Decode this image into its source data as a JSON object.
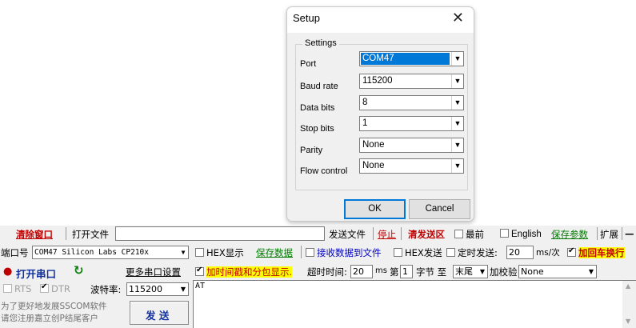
{
  "setup": {
    "title": "Setup",
    "close": "✕",
    "group": "Settings",
    "rows": [
      {
        "label": "Port",
        "value": "COM47"
      },
      {
        "label": "Baud rate",
        "value": "115200"
      },
      {
        "label": "Data bits",
        "value": "8"
      },
      {
        "label": "Stop bits",
        "value": "1"
      },
      {
        "label": "Parity",
        "value": "None"
      },
      {
        "label": "Flow control",
        "value": "None"
      }
    ],
    "ok": "OK",
    "cancel": "Cancel"
  },
  "toolbar": {
    "clear_window": "清除窗口",
    "open_file": "打开文件",
    "send_file": "发送文件",
    "stop": "停止",
    "clear_send": "清发送区",
    "topmost": "最前",
    "english": "English",
    "save_params": "保存参数",
    "expand": "扩展",
    "dash": "—"
  },
  "port": {
    "label": "端口号",
    "value": "COM47 Silicon Labs CP210x",
    "open_button": "打开串口",
    "more_settings": "更多串口设置",
    "rts": "RTS",
    "dtr": "DTR",
    "baud_label": "波特率:",
    "baud_value": "115200"
  },
  "options": {
    "hex_display": "HEX显示",
    "save_data": "保存数据",
    "recv_to_file": "接收数据到文件",
    "hex_send": "HEX发送",
    "timed_send": "定时发送:",
    "interval": "20",
    "interval_unit": "ms/次",
    "add_crlf": "加回车换行",
    "timestamp": "加时间戳和分包显示.",
    "timeout_label": "超时时间:",
    "timeout_value": "20",
    "timeout_unit": "ms",
    "byte_prefix": "第",
    "byte_value": "1",
    "byte_suffix": "字节 至",
    "tail_value": "末尾",
    "checksum_label": "加校验",
    "checksum_value": "None"
  },
  "promo": {
    "line1": "为了更好地发展SSCOM软件",
    "line2": "请您注册嘉立创P结尾客户"
  },
  "send_button": "发 送",
  "send_text": "AT"
}
